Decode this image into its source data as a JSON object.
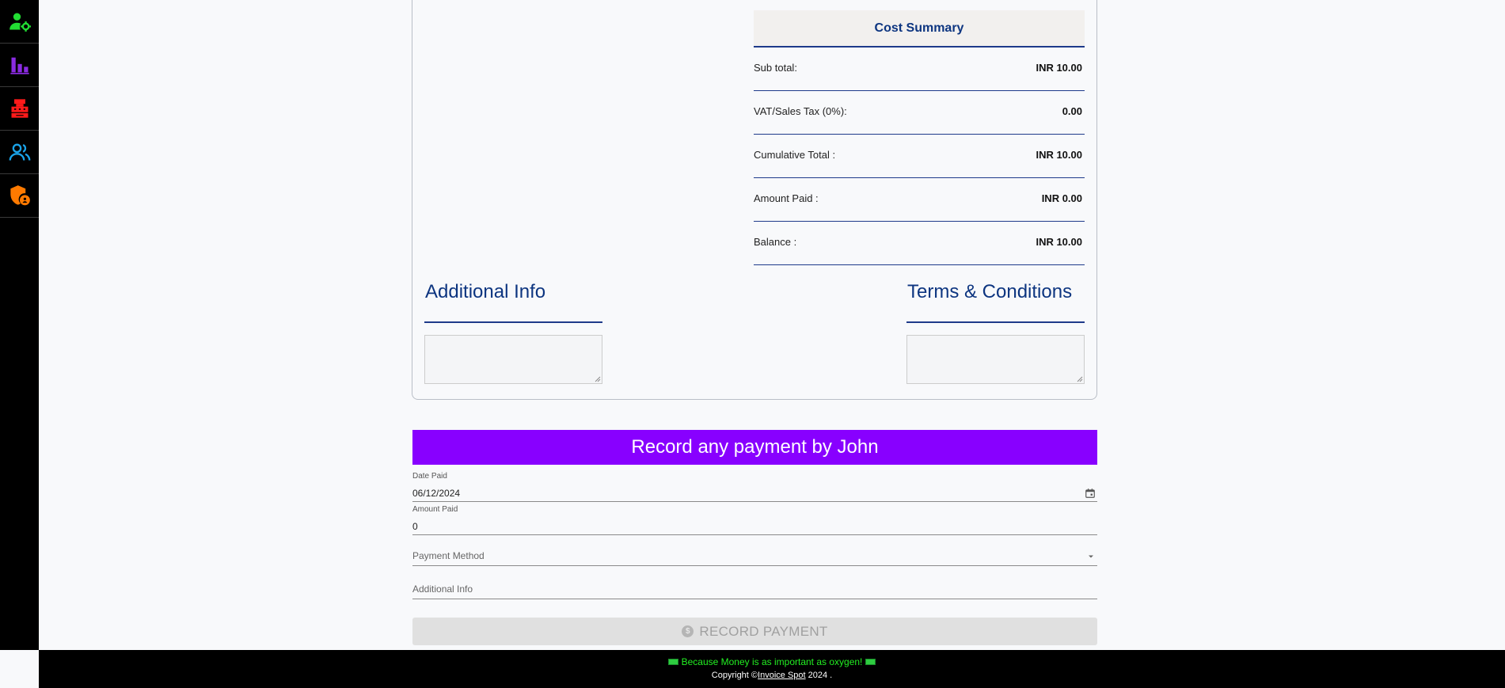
{
  "sidebar": {
    "items": [
      {
        "icon": "user-settings-icon",
        "color": "#22dd33"
      },
      {
        "icon": "bar-chart-icon",
        "color": "#8a2be2"
      },
      {
        "icon": "cash-register-icon",
        "color": "#ff1a1a"
      },
      {
        "icon": "users-icon",
        "color": "#1aa3e8"
      },
      {
        "icon": "shield-lock-icon",
        "color": "#ff7a00"
      }
    ]
  },
  "cost_summary": {
    "title": "Cost Summary",
    "rows": [
      {
        "label": "Sub total:",
        "value": "INR 10.00"
      },
      {
        "label": "VAT/Sales Tax (0%):",
        "value": "0.00"
      },
      {
        "label": "Cumulative Total :",
        "value": "INR 10.00"
      },
      {
        "label": "Amount Paid :",
        "value": "INR 0.00"
      },
      {
        "label": "Balance :",
        "value": "INR 10.00"
      }
    ]
  },
  "additional_info": {
    "title": "Additional Info",
    "value": ""
  },
  "terms": {
    "title": "Terms & Conditions",
    "value": ""
  },
  "payment": {
    "banner": "Record any payment by John",
    "date_label": "Date Paid",
    "date_value": "06/12/2024",
    "amount_label": "Amount Paid",
    "amount_value": "0",
    "method_placeholder": "Payment Method",
    "info_placeholder": "Additional Info",
    "button_label": "RECORD PAYMENT",
    "button_icon": "$"
  },
  "footer": {
    "tagline": "Because Money is as important as oxygen!",
    "copyright_prefix": "Copyright ©",
    "brand": "Invoice Spot",
    "copyright_suffix": " 2024 ."
  },
  "colors": {
    "accent_purple": "#8800ff",
    "navy": "#0d3580",
    "footer_green": "#22ee22"
  }
}
